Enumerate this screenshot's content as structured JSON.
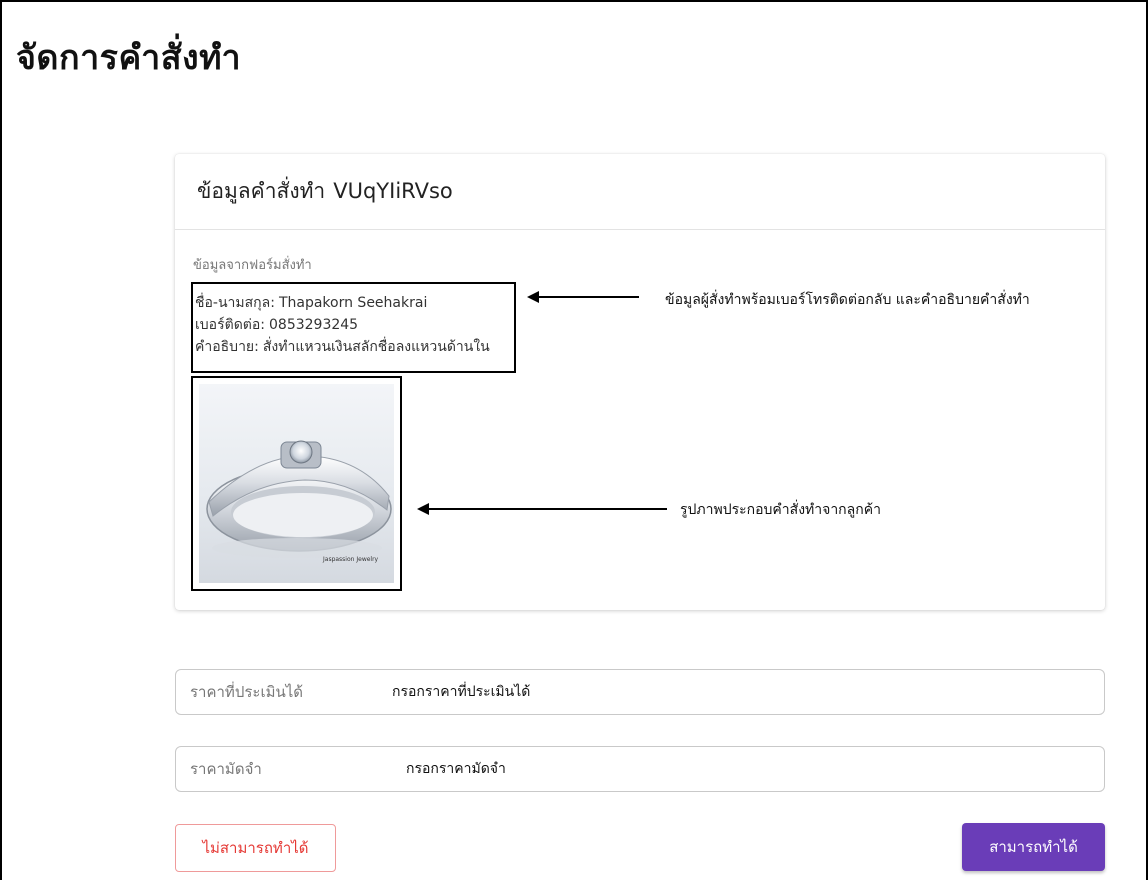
{
  "page": {
    "title": "จัดการคำสั่งทำ"
  },
  "order_card": {
    "title_prefix": "ข้อมูลคำสั่งทำ",
    "order_id": "VUqYIiRVso",
    "section_label": "ข้อมูลจากฟอร์มสั่งทำ",
    "customer_name_label": "ชื่อ-นามสกุล:",
    "customer_name": "Thapakorn Seehakrai",
    "phone_label": "เบอร์ติดต่อ:",
    "phone": "0853293245",
    "description_label": "คำอธิบาย:",
    "description": "สั่งทำแหวนเงินสลักชื่อลงแหวนด้านใน",
    "image_icon": "ring-photo",
    "image_watermark": "Jaspassion Jewelry"
  },
  "annotations": {
    "info_note": "ข้อมูลผู้สั่งทำพร้อมเบอร์โทรติดต่อกลับ และคำอธิบายคำสั่งทำ",
    "image_note": "รูปภาพประกอบคำสั่งทำจากลูกค้า"
  },
  "form": {
    "estimated_price": {
      "label": "ราคาที่ประเมินได้",
      "placeholder": "กรอกราคาที่ประเมินได้",
      "value": ""
    },
    "deposit_price": {
      "label": "ราคามัดจำ",
      "placeholder": "กรอกราคามัดจำ",
      "value": ""
    }
  },
  "actions": {
    "reject_label": "ไม่สามารถทำได้",
    "accept_label": "สามารถทำได้"
  },
  "colors": {
    "accent": "#6a3db8",
    "danger": "#e53935"
  }
}
